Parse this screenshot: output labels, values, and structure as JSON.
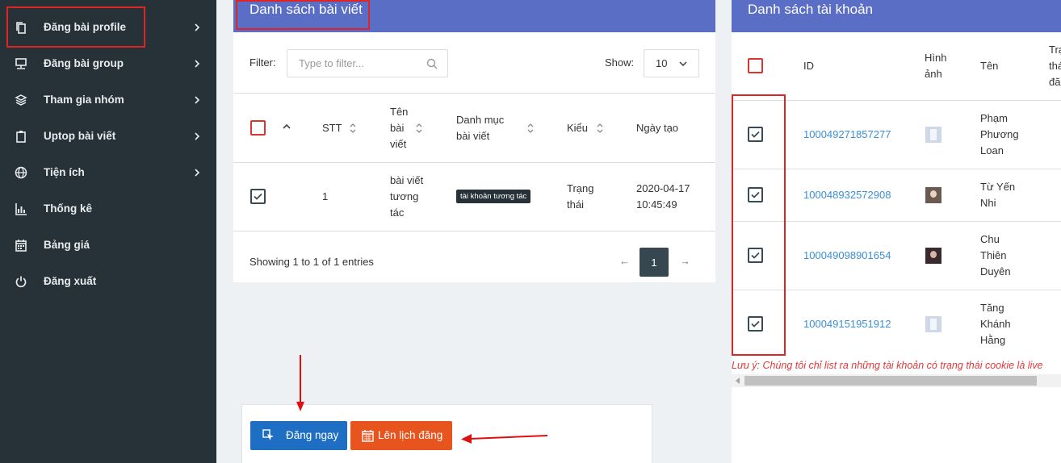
{
  "sidebar": {
    "items": [
      {
        "label": "Đăng bài profile",
        "icon": "copy-icon"
      },
      {
        "label": "Đăng bài group",
        "icon": "monitor-icon"
      },
      {
        "label": "Tham gia nhóm",
        "icon": "layers-icon"
      },
      {
        "label": "Uptop bài viết",
        "icon": "clipboard-icon"
      },
      {
        "label": "Tiện ích",
        "icon": "globe-icon"
      },
      {
        "label": "Thống kê",
        "icon": "bar-chart-icon"
      },
      {
        "label": "Bảng giá",
        "icon": "calendar-icon"
      },
      {
        "label": "Đăng xuất",
        "icon": "power-icon"
      }
    ]
  },
  "posts_panel": {
    "title": "Danh sách bài viết",
    "filter_label": "Filter:",
    "filter_placeholder": "Type to filter...",
    "show_label": "Show:",
    "show_value": "10",
    "columns": {
      "stt": "STT",
      "ten_1": "Tên",
      "ten_2": "bài",
      "ten_3": "viết",
      "danhmuc_1": "Danh mục",
      "danhmuc_2": "bài viết",
      "kieu": "Kiểu",
      "ngay": "Ngày tạo"
    },
    "row": {
      "stt": "1",
      "name_1": "bài viết",
      "name_2": "tương",
      "name_3": "tác",
      "category": "tài khoản tương tác",
      "type_1": "Trạng",
      "type_2": "thái",
      "date_1": "2020-04-17",
      "date_2": "10:45:49"
    },
    "showing": "Showing 1 to 1 of 1 entries",
    "pager": {
      "prev": "←",
      "page": "1",
      "next": "→"
    }
  },
  "actions": {
    "post_now": "Đăng ngay",
    "schedule": "Lên lịch đăng"
  },
  "accounts_panel": {
    "title": "Danh sách tài khoản",
    "columns": {
      "id": "ID",
      "image_1": "Hình",
      "image_2": "ảnh",
      "name": "Tên",
      "status_1": "Trạ",
      "status_2": "thá",
      "status_3": "đă"
    },
    "rows": [
      {
        "id": "100049271857277",
        "name_1": "Phạm",
        "name_2": "Phương",
        "name_3": "Loan"
      },
      {
        "id": "100048932572908",
        "name_1": "Từ Yến",
        "name_2": "Nhi",
        "name_3": ""
      },
      {
        "id": "100049098901654",
        "name_1": "Chu",
        "name_2": "Thiên",
        "name_3": "Duyên"
      },
      {
        "id": "100049151951912",
        "name_1": "Tăng",
        "name_2": "Khánh",
        "name_3": "Hằng"
      }
    ],
    "note": "Lưu ý: Chúng tôi chỉ list ra những tài khoản có trạng thái cookie là live"
  },
  "colors": {
    "sidebar_bg": "#263238",
    "header_blue": "#5a6ec5",
    "highlight_red": "#e02424",
    "btn_blue": "#1e6fc4",
    "btn_orange": "#e8541e",
    "link_blue": "#3b8fd6"
  }
}
